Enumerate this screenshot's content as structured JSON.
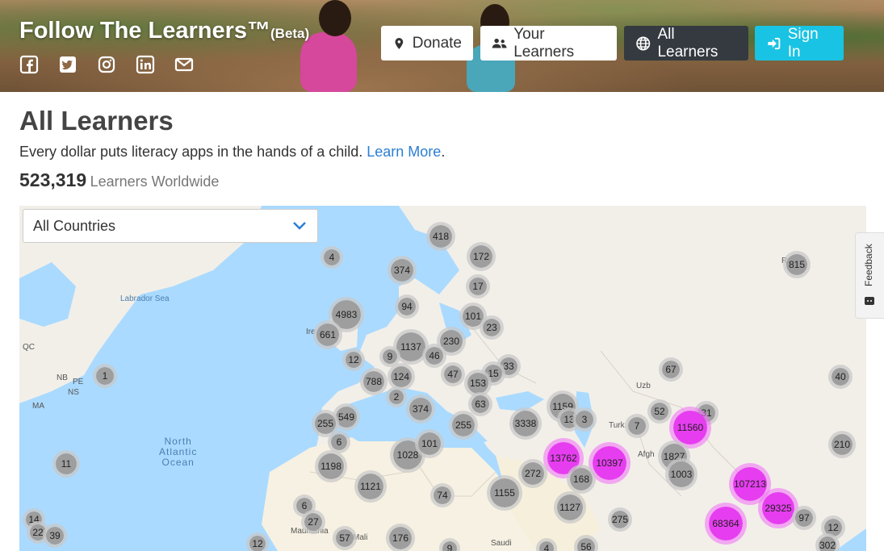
{
  "header": {
    "brand": "Follow The Learners™",
    "beta": "(Beta)",
    "social_icons": [
      "facebook-icon",
      "twitter-icon",
      "instagram-icon",
      "linkedin-icon",
      "envelope-icon"
    ],
    "nav": {
      "donate": "Donate",
      "your_learners": "Your Learners",
      "all_learners": "All Learners",
      "sign_in": "Sign In"
    },
    "colors": {
      "active_nav": "#343a40",
      "sign_in": "#19c3e3"
    }
  },
  "main": {
    "title": "All Learners",
    "tagline": "Every dollar puts literacy apps in the hands of a child.",
    "learn_more": "Learn More",
    "tagline_end": ".",
    "count": "523,319",
    "count_label": "Learners Worldwide"
  },
  "map": {
    "country_select": "All Countries",
    "labels": {
      "labrador_sea": "Labrador Sea",
      "north_atlantic_ocean": "North\nAtlantic\nOcean",
      "qc": "QC",
      "nb": "NB",
      "pe": "PE",
      "ns": "NS",
      "ma": "MA",
      "ir": "Ire",
      "afgh": "Afgh",
      "uzb": "Uzb",
      "turk": "Turk",
      "ru": "Ru",
      "saudi": "Saudi",
      "mali": "Mali",
      "mauritania": "Mauritania"
    },
    "clusters": [
      {
        "label": "418",
        "kind": "gray"
      },
      {
        "label": "172",
        "kind": "gray"
      },
      {
        "label": "4",
        "kind": "gray"
      },
      {
        "label": "374",
        "kind": "gray"
      },
      {
        "label": "17",
        "kind": "gray"
      },
      {
        "label": "94",
        "kind": "gray"
      },
      {
        "label": "4983",
        "kind": "gray"
      },
      {
        "label": "101",
        "kind": "gray"
      },
      {
        "label": "23",
        "kind": "gray"
      },
      {
        "label": "661",
        "kind": "gray"
      },
      {
        "label": "230",
        "kind": "gray"
      },
      {
        "label": "1137",
        "kind": "gray"
      },
      {
        "label": "12",
        "kind": "gray"
      },
      {
        "label": "9",
        "kind": "gray"
      },
      {
        "label": "46",
        "kind": "gray"
      },
      {
        "label": "33",
        "kind": "gray"
      },
      {
        "label": "15",
        "kind": "gray"
      },
      {
        "label": "788",
        "kind": "gray"
      },
      {
        "label": "124",
        "kind": "gray"
      },
      {
        "label": "47",
        "kind": "gray"
      },
      {
        "label": "153",
        "kind": "gray"
      },
      {
        "label": "67",
        "kind": "gray"
      },
      {
        "label": "40",
        "kind": "gray"
      },
      {
        "label": "815",
        "kind": "gray"
      },
      {
        "label": "1",
        "kind": "gray"
      },
      {
        "label": "2",
        "kind": "gray"
      },
      {
        "label": "374",
        "kind": "gray"
      },
      {
        "label": "63",
        "kind": "gray"
      },
      {
        "label": "1159",
        "kind": "gray"
      },
      {
        "label": "549",
        "kind": "gray"
      },
      {
        "label": "255",
        "kind": "gray"
      },
      {
        "label": "255",
        "kind": "gray"
      },
      {
        "label": "13",
        "kind": "gray"
      },
      {
        "label": "3",
        "kind": "gray"
      },
      {
        "label": "52",
        "kind": "gray"
      },
      {
        "label": "31",
        "kind": "gray"
      },
      {
        "label": "7",
        "kind": "gray"
      },
      {
        "label": "11560",
        "kind": "pink"
      },
      {
        "label": "3338",
        "kind": "gray"
      },
      {
        "label": "6",
        "kind": "gray"
      },
      {
        "label": "210",
        "kind": "gray"
      },
      {
        "label": "1028",
        "kind": "gray"
      },
      {
        "label": "101",
        "kind": "gray"
      },
      {
        "label": "1198",
        "kind": "gray"
      },
      {
        "label": "13762",
        "kind": "pink"
      },
      {
        "label": "10397",
        "kind": "pink"
      },
      {
        "label": "1827",
        "kind": "gray"
      },
      {
        "label": "11",
        "kind": "gray"
      },
      {
        "label": "272",
        "kind": "gray"
      },
      {
        "label": "1003",
        "kind": "gray"
      },
      {
        "label": "168",
        "kind": "gray"
      },
      {
        "label": "1121",
        "kind": "gray"
      },
      {
        "label": "107213",
        "kind": "pink"
      },
      {
        "label": "1155",
        "kind": "gray"
      },
      {
        "label": "74",
        "kind": "gray"
      },
      {
        "label": "29325",
        "kind": "pink"
      },
      {
        "label": "1127",
        "kind": "gray"
      },
      {
        "label": "6",
        "kind": "gray"
      },
      {
        "label": "14",
        "kind": "gray"
      },
      {
        "label": "97",
        "kind": "gray"
      },
      {
        "label": "275",
        "kind": "gray"
      },
      {
        "label": "27",
        "kind": "gray"
      },
      {
        "label": "68364",
        "kind": "pink"
      },
      {
        "label": "12",
        "kind": "gray"
      },
      {
        "label": "22",
        "kind": "gray"
      },
      {
        "label": "39",
        "kind": "gray"
      },
      {
        "label": "57",
        "kind": "gray"
      },
      {
        "label": "176",
        "kind": "gray"
      },
      {
        "label": "302",
        "kind": "gray"
      },
      {
        "label": "12",
        "kind": "gray"
      },
      {
        "label": "9",
        "kind": "gray"
      },
      {
        "label": "4",
        "kind": "gray"
      },
      {
        "label": "56",
        "kind": "gray"
      }
    ]
  },
  "feedback": {
    "label": "Feedback"
  }
}
